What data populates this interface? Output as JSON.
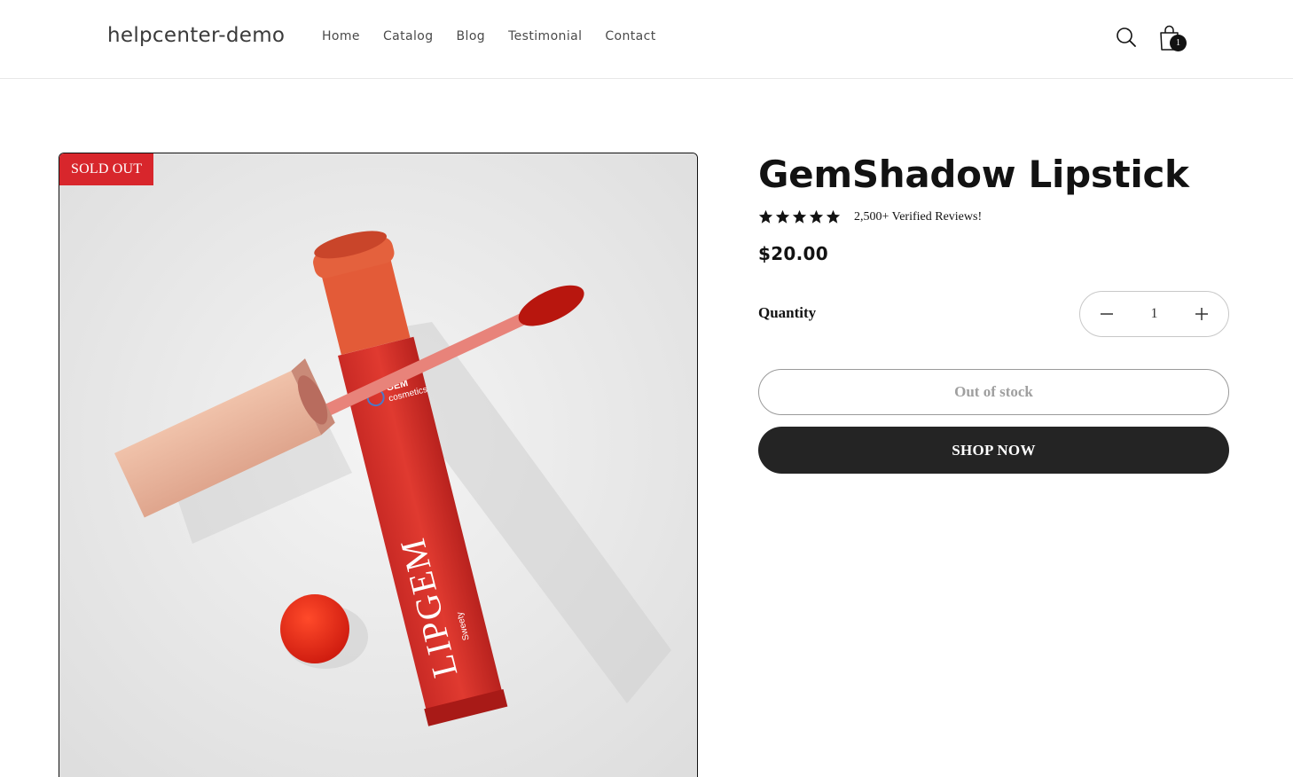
{
  "header": {
    "logo": "helpcenter-demo",
    "nav": [
      "Home",
      "Catalog",
      "Blog",
      "Testimonial",
      "Contact"
    ],
    "cart_count": "1",
    "icons": [
      "search-icon",
      "cart-icon"
    ]
  },
  "product": {
    "badge": "SOLD OUT",
    "title": "GemShadow Lipstick",
    "rating_stars": 5,
    "reviews_text": "2,500+ Verified Reviews!",
    "price": "$20.00",
    "quantity_label": "Quantity",
    "quantity_value": "1",
    "out_of_stock_label": "Out of stock",
    "shop_now_label": "SHOP NOW",
    "image_text": {
      "brand": "LIPGEM",
      "brand_sub": "Sweety",
      "logo_line1": "GEM",
      "logo_line2": "cosmetics"
    }
  },
  "colors": {
    "badge_bg": "#d8262c",
    "shop_button_bg": "#242424",
    "lipstick_red": "#d8322a",
    "cap_peach": "#e8b49c"
  }
}
